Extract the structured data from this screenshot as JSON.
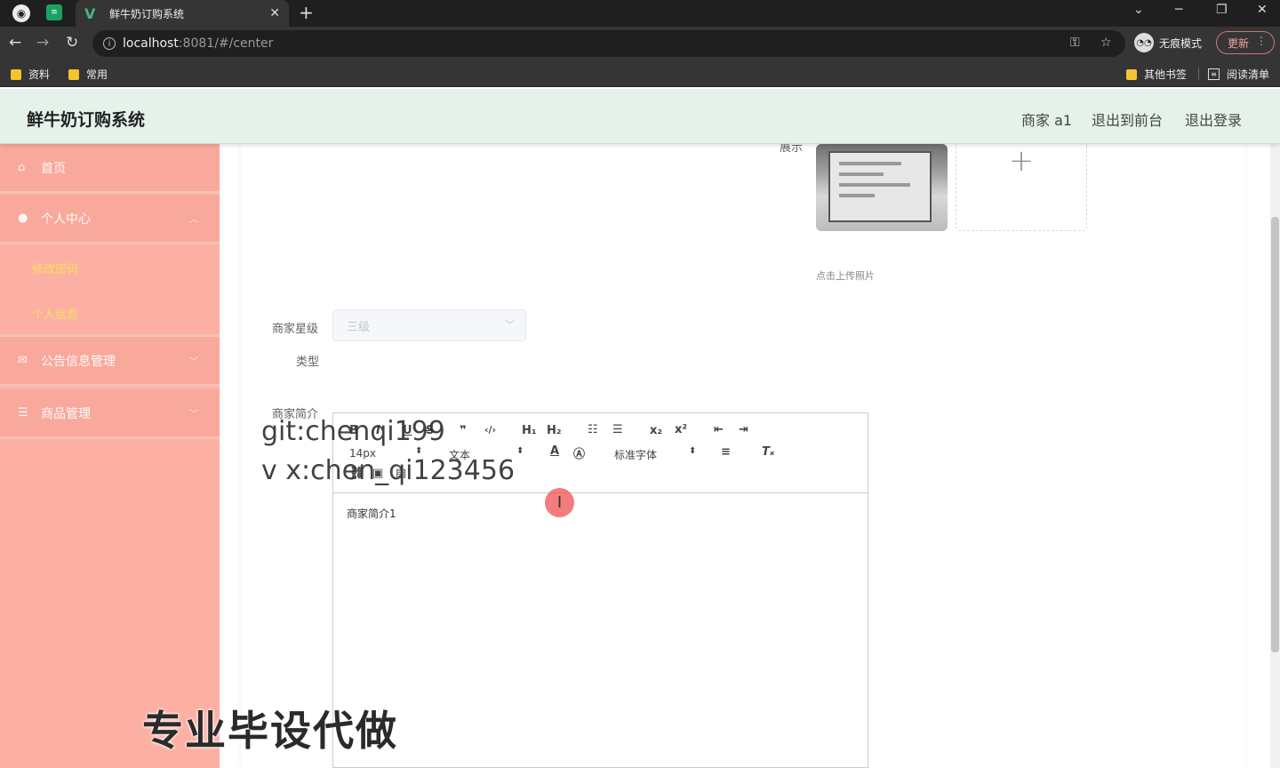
{
  "browser": {
    "tab_title": "鲜牛奶订购系统",
    "url_host": "localhost",
    "url_rest": ":8081/#/center",
    "incognito_label": "无痕模式",
    "update_label": "更新",
    "bookmarks": [
      "资料",
      "常用"
    ],
    "bookmarks_right": [
      "其他书签",
      "阅读清单"
    ]
  },
  "header": {
    "title": "鲜牛奶订购系统",
    "user": "商家 a1",
    "to_front": "退出到前台",
    "logout": "退出登录"
  },
  "sidebar": {
    "items": [
      {
        "label": "首页",
        "icon": "home-icon"
      },
      {
        "label": "个人中心",
        "icon": "user-icon"
      },
      {
        "label": "公告信息管理",
        "icon": "mail-icon"
      },
      {
        "label": "商品管理",
        "icon": "list-icon"
      }
    ],
    "sub_items": [
      "修改密码",
      "个人信息"
    ]
  },
  "form": {
    "show_label": "展示",
    "upload_hint": "点击上传照片",
    "star_label": "商家星级",
    "star_value": "三级",
    "type_label": "类型",
    "intro_label": "商家简介",
    "intro_content": "商家简介1"
  },
  "editor": {
    "font_size": "14px",
    "heading": "文本",
    "font_family": "标准字体"
  },
  "overlay": {
    "watermark_line1": "git:chenqi199",
    "watermark_line2": "v x:chen_qi123456",
    "promo": "专业毕设代做"
  },
  "colors": {
    "sidebar": "#fcb0a4",
    "header": "#e4f2ea",
    "submenu_text": "#f6e05a"
  }
}
